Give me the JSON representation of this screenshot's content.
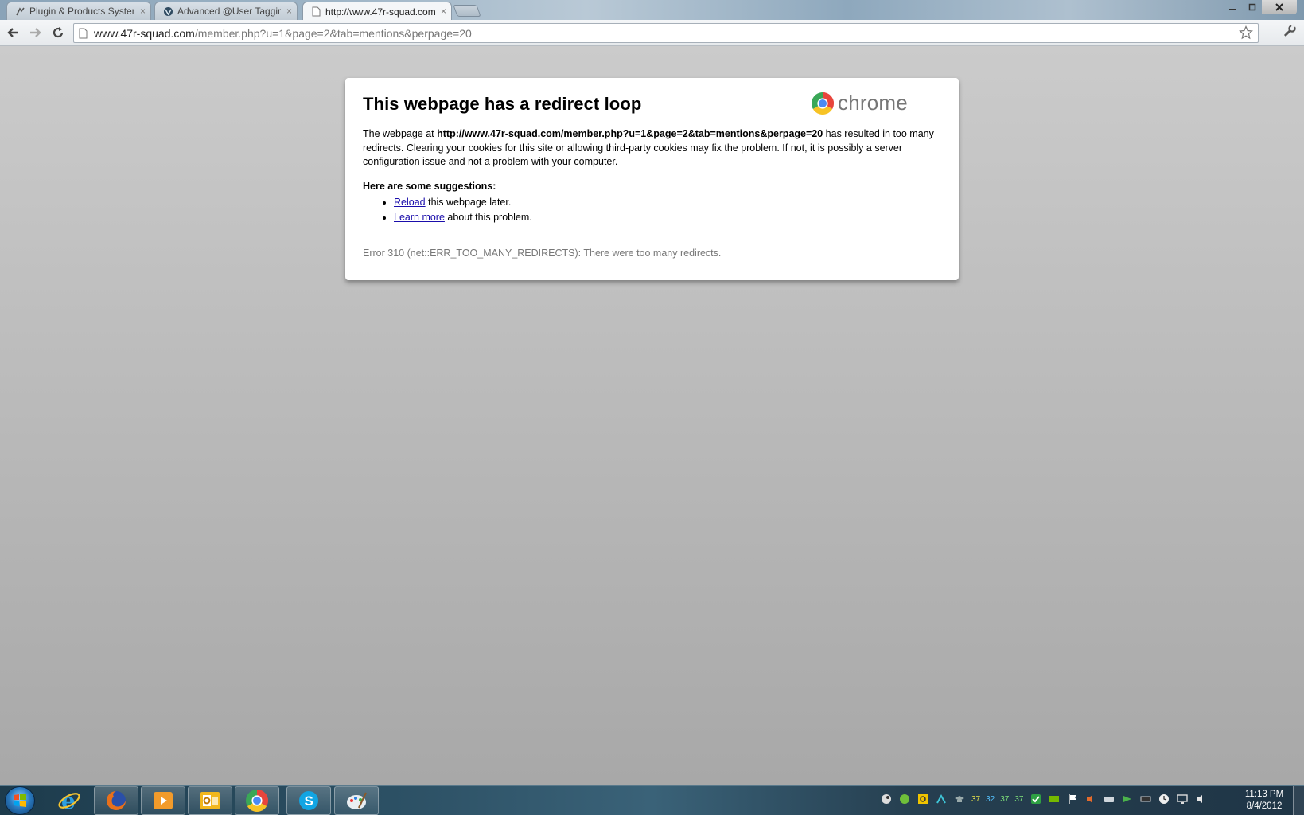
{
  "browser": {
    "tabs": [
      {
        "label": "Plugin & Products System",
        "favicon": "plugin-icon",
        "active": false
      },
      {
        "label": "Advanced @User Tagging",
        "favicon": "vbulletin-icon",
        "active": false
      },
      {
        "label": "http://www.47r-squad.com",
        "favicon": "page-icon",
        "active": true
      }
    ],
    "tab_close_glyph": "×",
    "omnibox": {
      "host": "www.47r-squad.com",
      "path": "/member.php?u=1&page=2&tab=mentions&perpage=20"
    }
  },
  "error_page": {
    "title": "This webpage has a redirect loop",
    "logo_word": "chrome",
    "desc_prefix": "The webpage at ",
    "desc_url": "http://www.47r-squad.com/member.php?u=1&page=2&tab=mentions&perpage=20",
    "desc_suffix": " has resulted in too many redirects. Clearing your cookies for this site or allowing third-party cookies may fix the problem. If not, it is possibly a server configuration issue and not a problem with your computer.",
    "suggestions_heading": "Here are some suggestions:",
    "suggestions": [
      {
        "link": "Reload",
        "rest": " this webpage later."
      },
      {
        "link": "Learn more",
        "rest": " about this problem."
      }
    ],
    "error_code": "Error 310 (net::ERR_TOO_MANY_REDIRECTS): There were too many redirects."
  },
  "taskbar": {
    "apps": [
      "internet-explorer-icon",
      "firefox-icon",
      "media-player-icon",
      "outlook-icon",
      "chrome-icon",
      "skype-icon",
      "paint-icon"
    ],
    "tray_numbers": [
      "37",
      "32",
      "37",
      "37"
    ],
    "clock_time": "11:13 PM",
    "clock_date": "8/4/2012"
  },
  "colors": {
    "link": "#1a0dab",
    "error_text": "#777777",
    "tray_number_colors": [
      "#e7e34a",
      "#55c2ff",
      "#7ee07a",
      "#7ee07a"
    ]
  }
}
